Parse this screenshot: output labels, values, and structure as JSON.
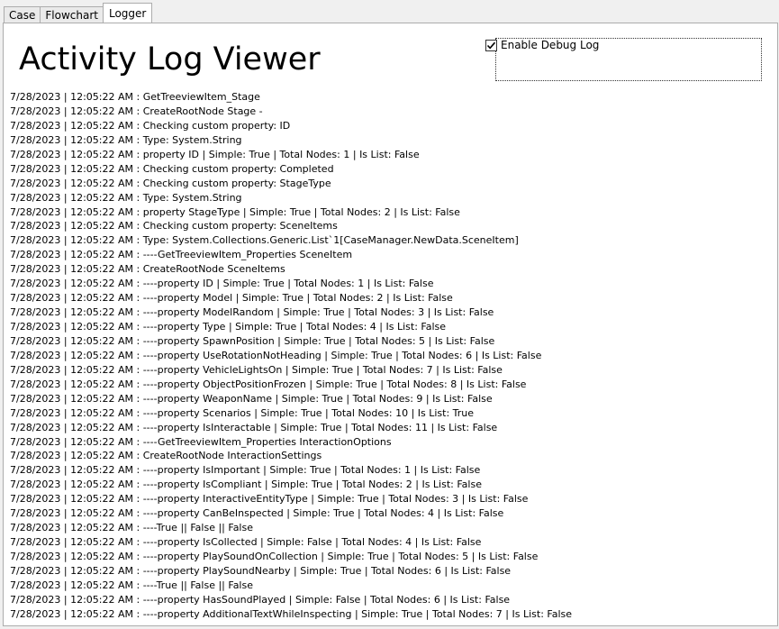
{
  "tabs": [
    {
      "label": "Case"
    },
    {
      "label": "Flowchart"
    },
    {
      "label": "Logger"
    }
  ],
  "active_tab": "Logger",
  "title": "Activity Log Viewer",
  "debug": {
    "label": "Enable Debug Log",
    "checked": true
  },
  "log_lines": [
    "7/28/2023 | 12:05:22 AM : GetTreeviewItem_Stage",
    "7/28/2023 | 12:05:22 AM : CreateRootNode Stage  -",
    "7/28/2023 | 12:05:22 AM : Checking custom property: ID",
    "7/28/2023 | 12:05:22 AM : Type: System.String",
    "7/28/2023 | 12:05:22 AM : property ID | Simple: True | Total Nodes: 1 | Is List: False",
    "7/28/2023 | 12:05:22 AM : Checking custom property: Completed",
    "7/28/2023 | 12:05:22 AM : Checking custom property: StageType",
    "7/28/2023 | 12:05:22 AM : Type: System.String",
    "7/28/2023 | 12:05:22 AM : property StageType | Simple: True | Total Nodes: 2 | Is List: False",
    "7/28/2023 | 12:05:22 AM : Checking custom property: SceneItems",
    "7/28/2023 | 12:05:22 AM : Type: System.Collections.Generic.List`1[CaseManager.NewData.SceneItem]",
    "7/28/2023 | 12:05:22 AM : ----GetTreeviewItem_Properties SceneItem",
    "7/28/2023 | 12:05:22 AM : CreateRootNode SceneItems",
    "7/28/2023 | 12:05:22 AM : ----property ID | Simple: True | Total Nodes: 1 | Is List: False",
    "7/28/2023 | 12:05:22 AM : ----property Model | Simple: True | Total Nodes: 2 | Is List: False",
    "7/28/2023 | 12:05:22 AM : ----property ModelRandom | Simple: True | Total Nodes: 3 | Is List: False",
    "7/28/2023 | 12:05:22 AM : ----property Type | Simple: True | Total Nodes: 4 | Is List: False",
    "7/28/2023 | 12:05:22 AM : ----property SpawnPosition | Simple: True | Total Nodes: 5 | Is List: False",
    "7/28/2023 | 12:05:22 AM : ----property UseRotationNotHeading | Simple: True | Total Nodes: 6 | Is List: False",
    "7/28/2023 | 12:05:22 AM : ----property VehicleLightsOn | Simple: True | Total Nodes: 7 | Is List: False",
    "7/28/2023 | 12:05:22 AM : ----property ObjectPositionFrozen | Simple: True | Total Nodes: 8 | Is List: False",
    "7/28/2023 | 12:05:22 AM : ----property WeaponName | Simple: True | Total Nodes: 9 | Is List: False",
    "7/28/2023 | 12:05:22 AM : ----property Scenarios | Simple: True | Total Nodes: 10 | Is List: True",
    "7/28/2023 | 12:05:22 AM : ----property IsInteractable | Simple: True | Total Nodes: 11 | Is List: False",
    "7/28/2023 | 12:05:22 AM : ----GetTreeviewItem_Properties InteractionOptions",
    "7/28/2023 | 12:05:22 AM : CreateRootNode InteractionSettings",
    "7/28/2023 | 12:05:22 AM : ----property IsImportant | Simple: True | Total Nodes: 1 | Is List: False",
    "7/28/2023 | 12:05:22 AM : ----property IsCompliant | Simple: True | Total Nodes: 2 | Is List: False",
    "7/28/2023 | 12:05:22 AM : ----property InteractiveEntityType | Simple: True | Total Nodes: 3 | Is List: False",
    "7/28/2023 | 12:05:22 AM : ----property CanBeInspected | Simple: True | Total Nodes: 4 | Is List: False",
    "7/28/2023 | 12:05:22 AM : ----True || False || False",
    "7/28/2023 | 12:05:22 AM : ----property IsCollected | Simple: False | Total Nodes: 4 | Is List: False",
    "7/28/2023 | 12:05:22 AM : ----property PlaySoundOnCollection | Simple: True | Total Nodes: 5 | Is List: False",
    "7/28/2023 | 12:05:22 AM : ----property PlaySoundNearby | Simple: True | Total Nodes: 6 | Is List: False",
    "7/28/2023 | 12:05:22 AM : ----True || False || False",
    "7/28/2023 | 12:05:22 AM : ----property HasSoundPlayed | Simple: False | Total Nodes: 6 | Is List: False",
    "7/28/2023 | 12:05:22 AM : ----property AdditionalTextWhileInspecting | Simple: True | Total Nodes: 7 | Is List: False"
  ]
}
